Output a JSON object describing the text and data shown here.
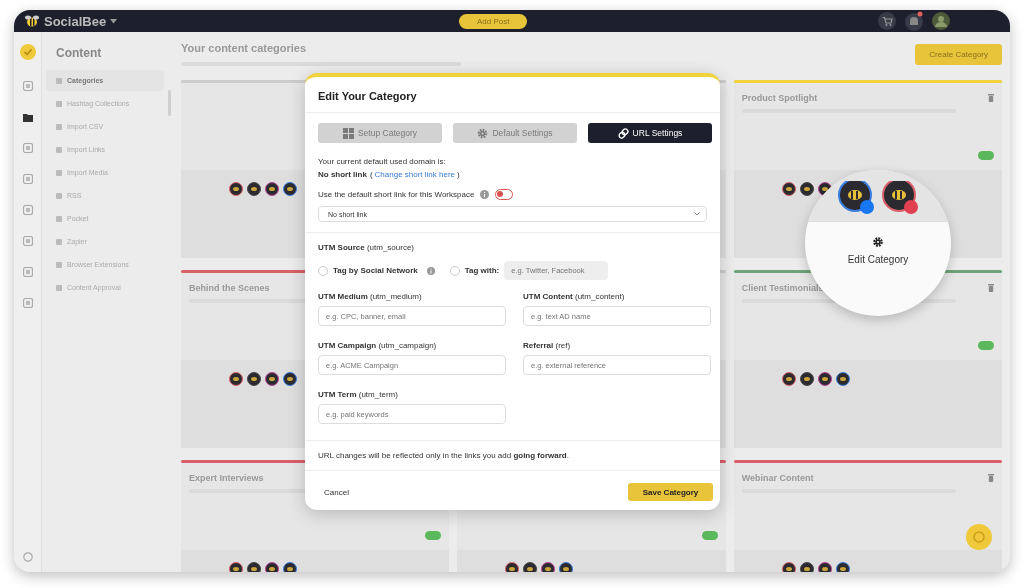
{
  "app": {
    "brand": "SocialBee",
    "add_post": "Add Post"
  },
  "sidebar": {
    "title": "Content",
    "items": [
      {
        "label": "Categories",
        "selected": true
      },
      {
        "label": "Hashtag Collections",
        "selected": false
      },
      {
        "label": "Import CSV",
        "selected": false
      },
      {
        "label": "Import Links",
        "selected": false
      },
      {
        "label": "Import Media",
        "selected": false
      },
      {
        "label": "RSS",
        "selected": false
      },
      {
        "label": "Pocket",
        "selected": false
      },
      {
        "label": "Zapier",
        "selected": false
      },
      {
        "label": "Browser Extensions",
        "selected": false
      },
      {
        "label": "Content Approval",
        "selected": false
      }
    ]
  },
  "main": {
    "title": "Your content categories",
    "create_button": "Create Category",
    "cards": [
      {
        "color": "#cccccc"
      },
      {
        "color": "#cccccc"
      },
      {
        "title": "Product Spotlight",
        "color": "#f0d23c",
        "active": true
      },
      {
        "title": "Behind the Scenes",
        "color": "#d9606a"
      },
      {
        "color": "#cccccc"
      },
      {
        "title": "Client Testimonials",
        "color": "#6fa27a",
        "active": true
      },
      {
        "title": "Expert Interviews",
        "color": "#d9606a",
        "active": true
      },
      {
        "color": "#d9606a",
        "active": true
      },
      {
        "title": "Webinar Content",
        "color": "#d9606a"
      }
    ]
  },
  "magnifier": {
    "label": "Edit Category"
  },
  "modal": {
    "title": "Edit Your Category",
    "tabs": [
      {
        "label": "Setup Category",
        "selected": false
      },
      {
        "label": "Default Settings",
        "selected": false
      },
      {
        "label": "URL Settings",
        "selected": true
      }
    ],
    "domain_text": "Your current default used domain is:",
    "short_link": "No short link",
    "paren_open": "(",
    "change_link": "Change short link here",
    "paren_close": ")",
    "toggle_label": "Use the default short link for this Workspace",
    "toggle_on": false,
    "select_value": "No short link",
    "source_label": "**UTM Source** (utm_source)",
    "radios": [
      {
        "kind": "network",
        "label": "Tag by Social Network",
        "selected": false
      },
      {
        "kind": "custom",
        "label": "Tag with:",
        "selected": false,
        "placeholder": "e.g. Twitter, Facebook"
      }
    ],
    "fields": [
      {
        "label": "**UTM Medium** (utm_medium)",
        "placeholder": "e.g. CPC, banner, email"
      },
      {
        "label": "**UTM Content** (utm_content)",
        "placeholder": "e.g. text AD name"
      },
      {
        "label": "**UTM Campaign** (utm_campaign)",
        "placeholder": "e.g. ACME Campaign"
      },
      {
        "label": "**Referral** (ref)",
        "placeholder": "e.g. external reference"
      },
      {
        "label": "**UTM Term** (utm_term)",
        "placeholder": "e.g. paid keywords"
      }
    ],
    "note": "URL changes will be reflected only in the links you add **going forward**.",
    "cancel": "Cancel",
    "save": "Save Category"
  }
}
